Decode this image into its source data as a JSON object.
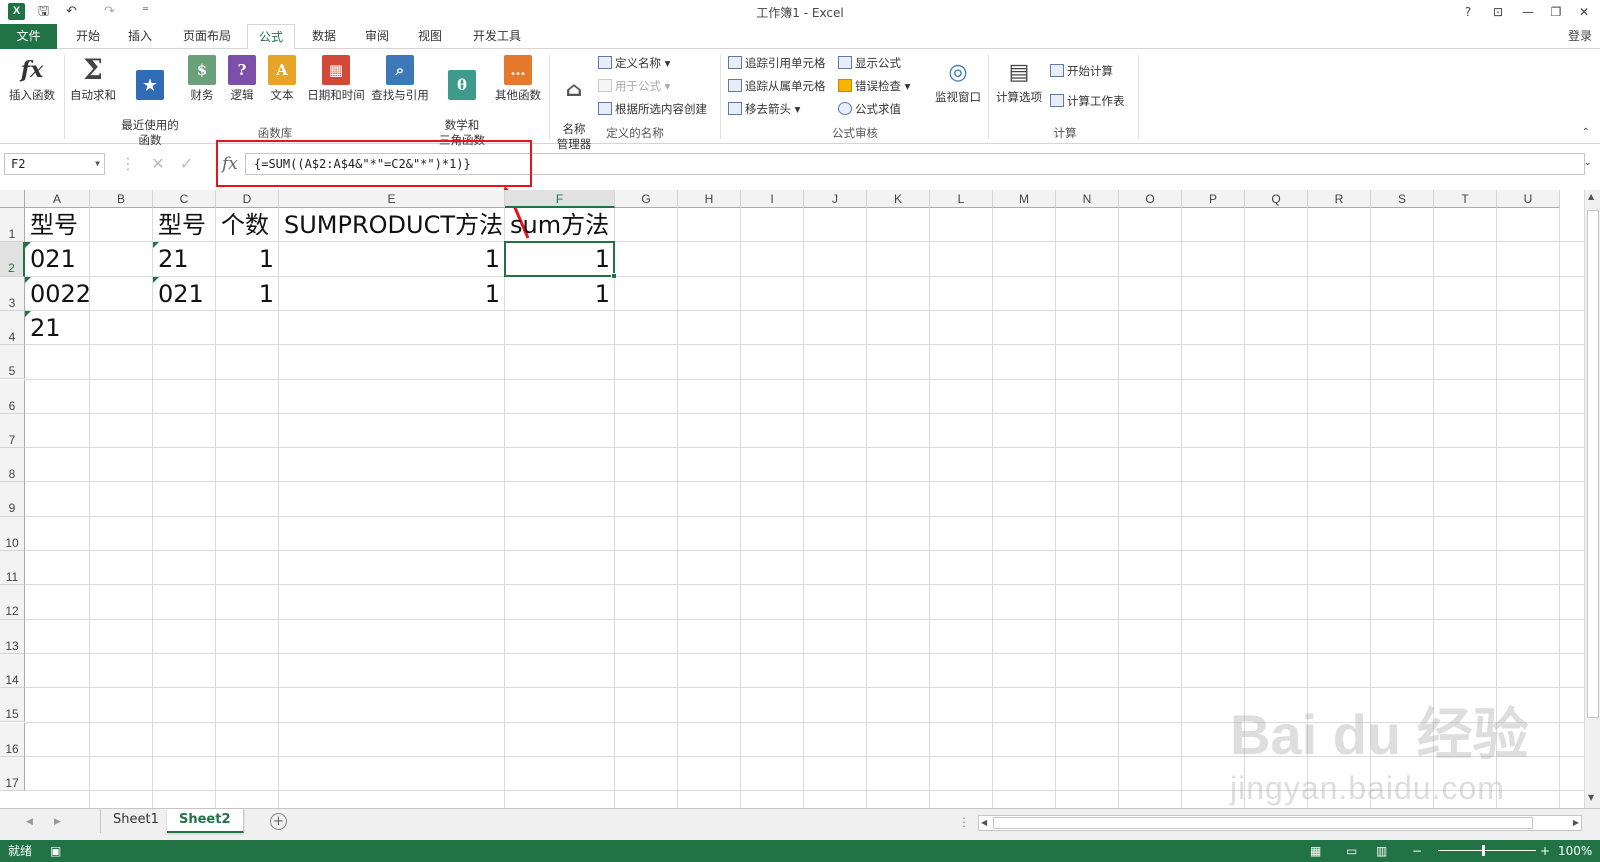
{
  "window": {
    "title": "工作簿1 - Excel",
    "login": "登录",
    "quick_access": {
      "save": "🖫",
      "undo": "↶",
      "redo": "↷",
      "customize": "⁼"
    },
    "controls": {
      "help": "?",
      "restore_ribbon": "⊡",
      "minimize": "—",
      "maximize": "❐",
      "close": "✕"
    },
    "logo": "X"
  },
  "tabs": [
    "文件",
    "开始",
    "插入",
    "页面布局",
    "公式",
    "数据",
    "审阅",
    "视图",
    "开发工具"
  ],
  "active_tab": "公式",
  "ribbon": {
    "function_library": {
      "label": "函数库",
      "buttons": [
        "插入函数",
        "自动求和",
        "最近使用的\n函数",
        "财务",
        "逻辑",
        "文本",
        "日期和时间",
        "查找与引用",
        "数学和\n三角函数",
        "其他函数"
      ]
    },
    "defined_names": {
      "label": "定义的名称",
      "name_manager": "名称\n管理器",
      "define_name": "定义名称",
      "use_in_formula": "用于公式",
      "create_from_selection": "根据所选内容创建"
    },
    "formula_auditing": {
      "label": "公式审核",
      "trace_precedents": "追踪引用单元格",
      "trace_dependents": "追踪从属单元格",
      "remove_arrows": "移去箭头",
      "show_formulas": "显示公式",
      "error_checking": "错误检查",
      "evaluate_formula": "公式求值",
      "watch_window": "监视窗口"
    },
    "calculation": {
      "label": "计算",
      "options": "计算选项",
      "calc_now": "开始计算",
      "calc_sheet": "计算工作表"
    }
  },
  "formula_bar": {
    "name_box": "F2",
    "fx": "fx",
    "formula": "{=SUM((A$2:A$4&\"*\"=C2&\"*\")*1)}"
  },
  "columns": [
    "A",
    "B",
    "C",
    "D",
    "E",
    "F",
    "G",
    "H",
    "I",
    "J",
    "K",
    "L",
    "M",
    "N",
    "O",
    "P",
    "Q",
    "R",
    "S",
    "T",
    "U"
  ],
  "rows": [
    "1",
    "2",
    "3",
    "4",
    "5",
    "6",
    "7",
    "8",
    "9",
    "10",
    "11",
    "12",
    "13",
    "14",
    "15",
    "16",
    "17"
  ],
  "cells": {
    "A1": "型号",
    "C1": "型号",
    "D1": "个数",
    "E1": "SUMPRODUCT方法",
    "F1": "sum方法",
    "A2": "021",
    "C2": "21",
    "D2": "1",
    "E2": "1",
    "F2": "1",
    "A3": "0022",
    "C3": "021",
    "D3": "1",
    "E3": "1",
    "F3": "1",
    "A4": "21"
  },
  "selected_cell": "F2",
  "sheets": [
    "Sheet1",
    "Sheet2"
  ],
  "active_sheet": "Sheet2",
  "status": {
    "ready": "就绪",
    "zoom": "100%"
  },
  "watermark": {
    "brand": "Bai du 经验",
    "url": "jingyan.baidu.com"
  },
  "colors": {
    "excel_green": "#217346",
    "highlight_red": "#e8141c"
  }
}
